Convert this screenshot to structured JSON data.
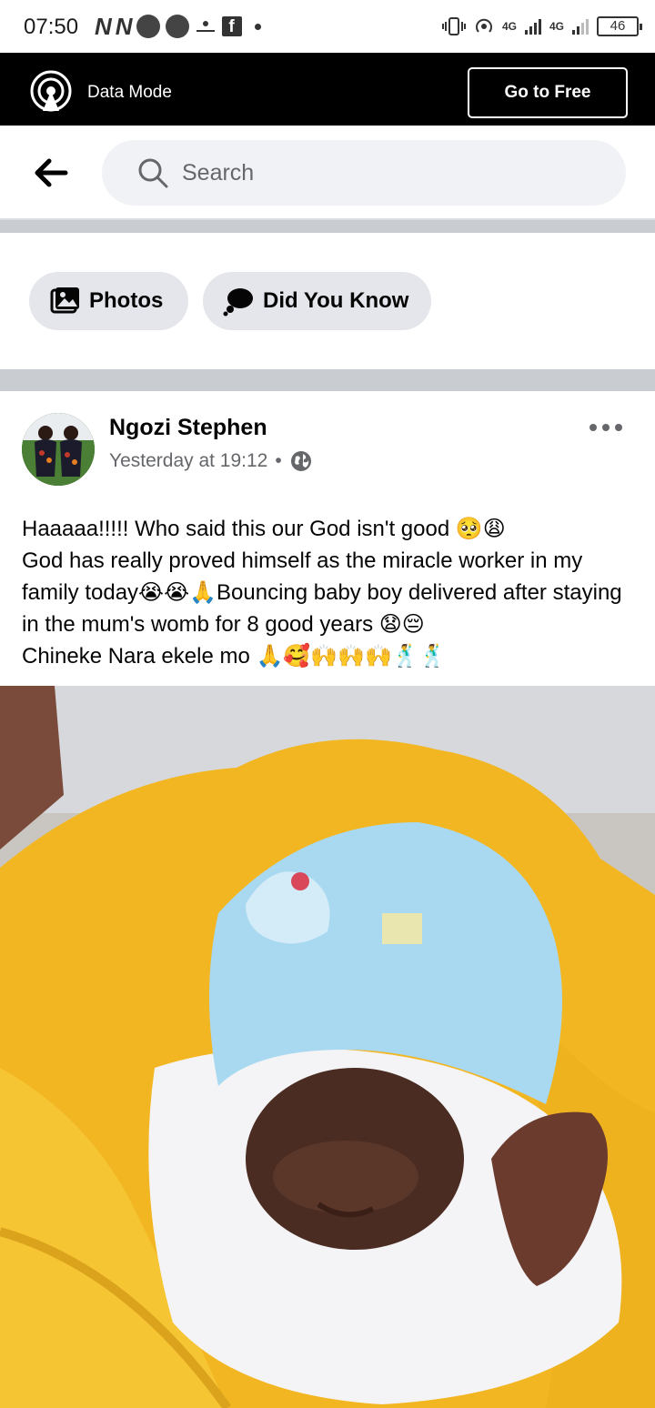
{
  "status_bar": {
    "time": "07:50",
    "network_labels": [
      "4G",
      "4G"
    ],
    "battery": "46"
  },
  "data_bar": {
    "label": "Data Mode",
    "go_free": "Go to Free"
  },
  "header": {
    "search_placeholder": "Search"
  },
  "chips": [
    {
      "label": "Photos",
      "icon": "photos-icon"
    },
    {
      "label": "Did You Know",
      "icon": "thought-bubble-icon"
    }
  ],
  "post": {
    "author": "Ngozi Stephen",
    "timestamp": "Yesterday at 19:12",
    "separator": "•",
    "privacy": "globe-icon",
    "text": "Haaaaa!!!!! Who said this our God isn't good 🥺😩\nGod has really proved himself as the miracle worker in my family today😭😭🙏Bouncing baby boy delivered after staying in the mum's womb for 8 good years 😧😔\nChineke Nara ekele mo 🙏🥰🙌🙌🙌🕺🕺"
  },
  "colors": {
    "data_bar_bg": "#000000",
    "search_bg": "#f0f2f5",
    "chip_bg": "#e4e6eb",
    "secondary_text": "#65676b",
    "divider": "#c9ccd1"
  }
}
